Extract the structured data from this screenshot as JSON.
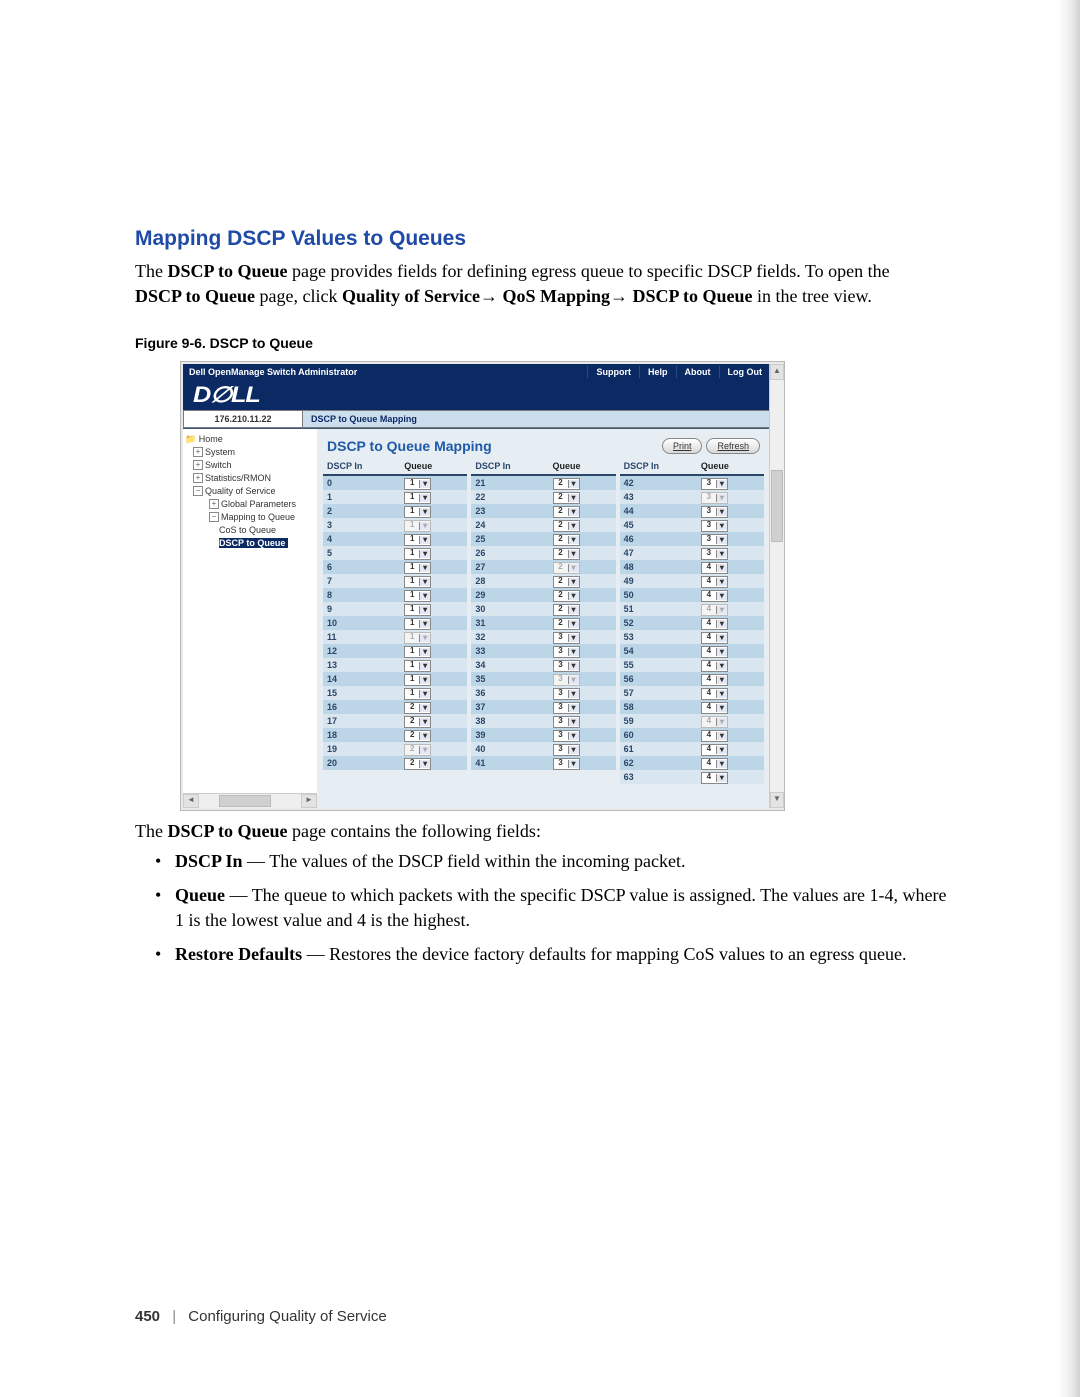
{
  "section_title": "Mapping DSCP Values to Queues",
  "intro_line1_pre": "The ",
  "intro_line1_b1": "DSCP to Queue",
  "intro_line1_mid": " page provides fields for defining egress queue to specific DSCP fields. To open the ",
  "intro_line2_b1": "DSCP to Queue",
  "intro_line2_mid1": " page, click ",
  "intro_line2_b2": "Quality of Service",
  "intro_arrow": "→ ",
  "intro_line2_b3": "QoS Mapping",
  "intro_line2_b4": "DSCP to Queue",
  "intro_line2_end": " in the tree view.",
  "figure_caption": "Figure 9-6.    DSCP to Queue",
  "app": {
    "title": "Dell OpenManage Switch Administrator",
    "links": {
      "support": "Support",
      "help": "Help",
      "about": "About",
      "logout": "Log Out"
    },
    "logo": "D∅LL",
    "ip": "176.210.11.22",
    "crumb": "DSCP to Queue Mapping"
  },
  "tree": {
    "home": "Home",
    "system": "System",
    "switch": "Switch",
    "stats": "Statistics/RMON",
    "qos": "Quality of Service",
    "global": "Global Parameters",
    "mapping": "Mapping to Queue",
    "cos": "CoS to Queue",
    "dscp": "DSCP to Queue"
  },
  "content": {
    "title": "DSCP to Queue Mapping",
    "print": "Print",
    "refresh": "Refresh",
    "head_dscp": "DSCP In",
    "head_queue": "Queue"
  },
  "chart_data": {
    "type": "table",
    "title": "DSCP to Queue Mapping",
    "columns": [
      "DSCP In",
      "Queue",
      "enabled"
    ],
    "rows": [
      [
        0,
        1,
        true
      ],
      [
        1,
        1,
        true
      ],
      [
        2,
        1,
        true
      ],
      [
        3,
        1,
        false
      ],
      [
        4,
        1,
        true
      ],
      [
        5,
        1,
        true
      ],
      [
        6,
        1,
        true
      ],
      [
        7,
        1,
        true
      ],
      [
        8,
        1,
        true
      ],
      [
        9,
        1,
        true
      ],
      [
        10,
        1,
        true
      ],
      [
        11,
        1,
        false
      ],
      [
        12,
        1,
        true
      ],
      [
        13,
        1,
        true
      ],
      [
        14,
        1,
        true
      ],
      [
        15,
        1,
        true
      ],
      [
        16,
        2,
        true
      ],
      [
        17,
        2,
        true
      ],
      [
        18,
        2,
        true
      ],
      [
        19,
        2,
        false
      ],
      [
        20,
        2,
        true
      ],
      [
        21,
        2,
        true
      ],
      [
        22,
        2,
        true
      ],
      [
        23,
        2,
        true
      ],
      [
        24,
        2,
        true
      ],
      [
        25,
        2,
        true
      ],
      [
        26,
        2,
        true
      ],
      [
        27,
        2,
        false
      ],
      [
        28,
        2,
        true
      ],
      [
        29,
        2,
        true
      ],
      [
        30,
        2,
        true
      ],
      [
        31,
        2,
        true
      ],
      [
        32,
        3,
        true
      ],
      [
        33,
        3,
        true
      ],
      [
        34,
        3,
        true
      ],
      [
        35,
        3,
        false
      ],
      [
        36,
        3,
        true
      ],
      [
        37,
        3,
        true
      ],
      [
        38,
        3,
        true
      ],
      [
        39,
        3,
        true
      ],
      [
        40,
        3,
        true
      ],
      [
        41,
        3,
        true
      ],
      [
        42,
        3,
        true
      ],
      [
        43,
        3,
        false
      ],
      [
        44,
        3,
        true
      ],
      [
        45,
        3,
        true
      ],
      [
        46,
        3,
        true
      ],
      [
        47,
        3,
        true
      ],
      [
        48,
        4,
        true
      ],
      [
        49,
        4,
        true
      ],
      [
        50,
        4,
        true
      ],
      [
        51,
        4,
        false
      ],
      [
        52,
        4,
        true
      ],
      [
        53,
        4,
        true
      ],
      [
        54,
        4,
        true
      ],
      [
        55,
        4,
        true
      ],
      [
        56,
        4,
        true
      ],
      [
        57,
        4,
        true
      ],
      [
        58,
        4,
        true
      ],
      [
        59,
        4,
        false
      ],
      [
        60,
        4,
        true
      ],
      [
        61,
        4,
        true
      ],
      [
        62,
        4,
        true
      ],
      [
        63,
        4,
        true
      ]
    ],
    "column_splits": [
      [
        0,
        20
      ],
      [
        21,
        41
      ],
      [
        42,
        63
      ]
    ]
  },
  "below_intro_pre": "The ",
  "below_intro_b": "DSCP to Queue",
  "below_intro_post": " page contains the following fields:",
  "bullets": [
    {
      "term": "DSCP In",
      "text": " — The values of the DSCP field within the incoming packet."
    },
    {
      "term": "Queue",
      "text": " — The queue to which packets with the specific DSCP value is assigned. The values are 1-4, where 1 is the lowest value and 4 is the highest."
    },
    {
      "term": "Restore Defaults",
      "text": " — Restores the device factory defaults for mapping CoS values to an egress queue."
    }
  ],
  "footer": {
    "page": "450",
    "chapter": "Configuring Quality of Service"
  }
}
